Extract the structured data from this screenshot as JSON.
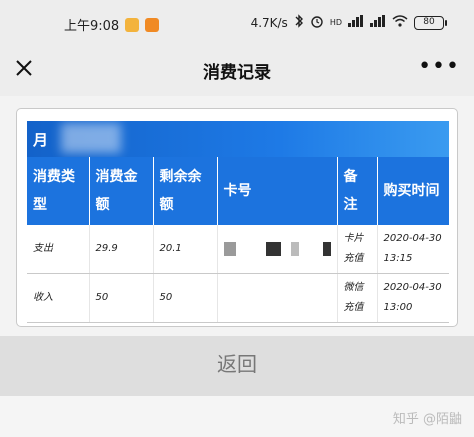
{
  "status_bar": {
    "time": "上午9:08",
    "speed": "4.7K/s",
    "signal_label": "HD",
    "battery": "80"
  },
  "nav": {
    "title": "消费记录",
    "more": "•••"
  },
  "card": {
    "month_label": "月",
    "columns": [
      "消费类型",
      "消费金额",
      "剩余余额",
      "卡号",
      "备注",
      "购买时间"
    ],
    "rows": [
      {
        "type": "支出",
        "amount": "29.9",
        "balance": "20.1",
        "note": "卡片充值",
        "time": "2020-04-30 13:15"
      },
      {
        "type": "收入",
        "amount": "50",
        "balance": "50",
        "note": "微信充值",
        "time": "2020-04-30 13:00"
      }
    ]
  },
  "return_label": "返回",
  "watermark": "知乎 @陌鼬",
  "colors": {
    "header_blue": "#1c73de",
    "accent_orange": "#f08a24"
  }
}
